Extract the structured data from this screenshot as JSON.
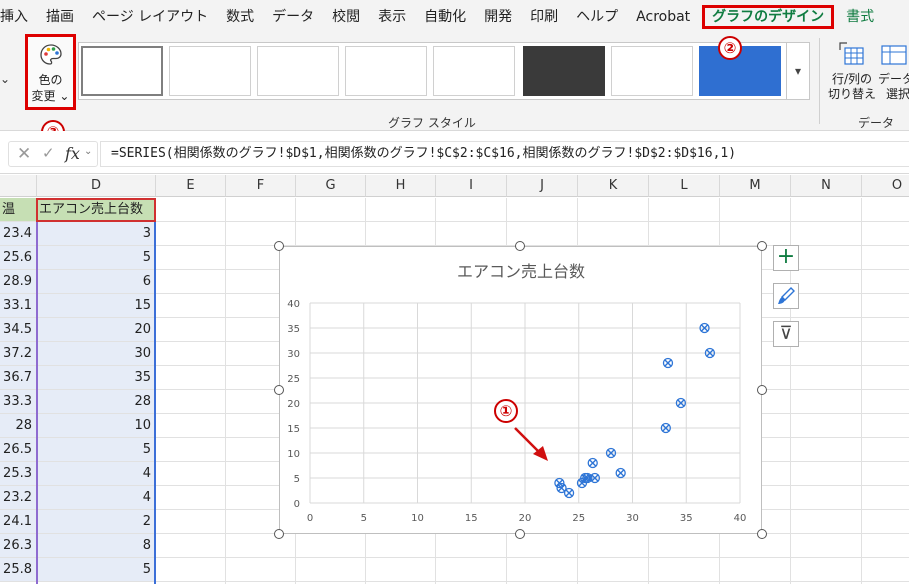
{
  "tabs": [
    "挿入",
    "描画",
    "ページ レイアウト",
    "数式",
    "データ",
    "校閲",
    "表示",
    "自動化",
    "開発",
    "印刷",
    "ヘルプ",
    "Acrobat",
    "グラフのデザイン",
    "書式"
  ],
  "ribbon": {
    "change_colors_line1": "色の",
    "change_colors_line2": "変更",
    "dropdown_glyph": "⌄",
    "chart_styles_label": "グラフ スタイル",
    "data_group_label": "データ",
    "switch_row_col_line1": "行/列の",
    "switch_row_col_line2": "切り替え",
    "select_data_line1": "データ",
    "select_data_line2": "選択",
    "left_stub": "⌄"
  },
  "annotations": {
    "one": "①",
    "two": "②",
    "three": "③"
  },
  "formula_bar": {
    "formula": "=SERIES(相関係数のグラフ!$D$1,相関係数のグラフ!$C$2:$C$16,相関係数のグラフ!$D$2:$D$16,1)"
  },
  "grid": {
    "columns": [
      "D",
      "E",
      "F",
      "G",
      "H",
      "I",
      "J",
      "K",
      "L",
      "M",
      "N",
      "O"
    ],
    "col_c_header": "温",
    "col_d_header": "エアコン売上台数",
    "rows": [
      [
        "23.4",
        "3"
      ],
      [
        "25.6",
        "5"
      ],
      [
        "28.9",
        "6"
      ],
      [
        "33.1",
        "15"
      ],
      [
        "34.5",
        "20"
      ],
      [
        "37.2",
        "30"
      ],
      [
        "36.7",
        "35"
      ],
      [
        "33.3",
        "28"
      ],
      [
        "28",
        "10"
      ],
      [
        "26.5",
        "5"
      ],
      [
        "25.3",
        "4"
      ],
      [
        "23.2",
        "4"
      ],
      [
        "24.1",
        "2"
      ],
      [
        "26.3",
        "8"
      ],
      [
        "25.8",
        "5"
      ]
    ]
  },
  "chart_data": {
    "type": "scatter",
    "title": "エアコン売上台数",
    "xlim": [
      0,
      40
    ],
    "ylim": [
      0,
      40
    ],
    "xticks": [
      0,
      5,
      10,
      15,
      20,
      25,
      30,
      35,
      40
    ],
    "yticks": [
      0,
      5,
      10,
      15,
      20,
      25,
      30,
      35,
      40
    ],
    "grid": true,
    "series": [
      {
        "points": [
          [
            23.4,
            3
          ],
          [
            25.6,
            5
          ],
          [
            28.9,
            6
          ],
          [
            33.1,
            15
          ],
          [
            34.5,
            20
          ],
          [
            37.2,
            30
          ],
          [
            36.7,
            35
          ],
          [
            33.3,
            28
          ],
          [
            28,
            10
          ],
          [
            26.5,
            5
          ],
          [
            25.3,
            4
          ],
          [
            23.2,
            4
          ],
          [
            24.1,
            2
          ],
          [
            26.3,
            8
          ],
          [
            25.8,
            5
          ]
        ]
      }
    ]
  },
  "chart_side_buttons": {
    "add": "+",
    "filter": "⊽"
  },
  "colors": {
    "accent_green": "#107c41",
    "marker": "#2e75d6",
    "annotation_red": "#cc0000"
  }
}
